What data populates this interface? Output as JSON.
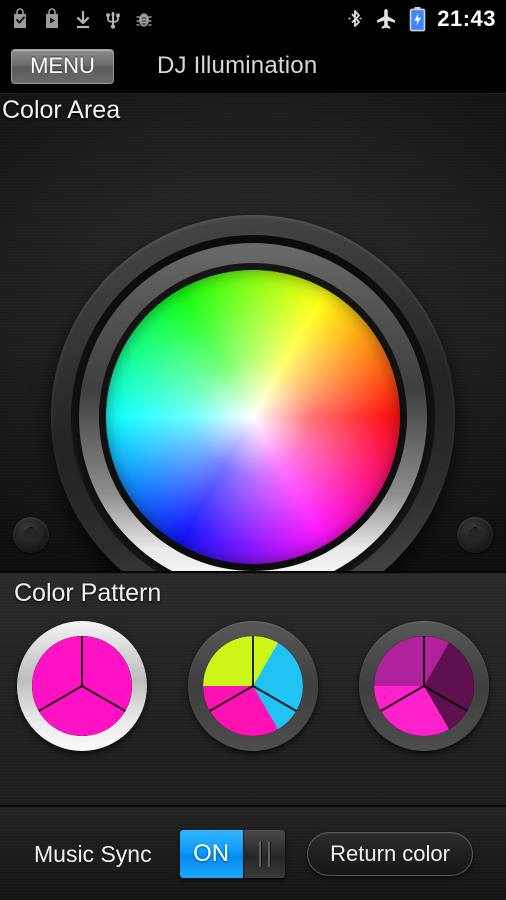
{
  "status_bar": {
    "left_icons": [
      {
        "name": "app-install-check-icon",
        "glyph": "check-bag"
      },
      {
        "name": "play-store-icon",
        "glyph": "play-bag"
      },
      {
        "name": "download-icon",
        "glyph": "download"
      },
      {
        "name": "usb-icon",
        "glyph": "usb"
      },
      {
        "name": "usb-debug-icon",
        "glyph": "bug"
      }
    ],
    "right_icons": [
      {
        "name": "bluetooth-icon",
        "glyph": "bluetooth"
      },
      {
        "name": "airplane-mode-icon",
        "glyph": "airplane"
      },
      {
        "name": "battery-charging-icon",
        "glyph": "battery"
      }
    ],
    "clock": "21:43"
  },
  "title_bar": {
    "menu_label": "MENU",
    "app_title": "DJ Illumination"
  },
  "color_area": {
    "section_label": "Color Area",
    "wheel": {
      "type": "hsv-color-wheel",
      "center_color": "#ffffff",
      "hue_stops": [
        {
          "angle_deg": 0,
          "color": "#ff0000"
        },
        {
          "angle_deg": 60,
          "color": "#ffff00"
        },
        {
          "angle_deg": 120,
          "color": "#00ff00"
        },
        {
          "angle_deg": 180,
          "color": "#00ffff"
        },
        {
          "angle_deg": 240,
          "color": "#0000ff"
        },
        {
          "angle_deg": 300,
          "color": "#ff00ff"
        }
      ]
    },
    "screws": [
      "screw-left",
      "screw-right"
    ]
  },
  "color_pattern": {
    "section_label": "Color Pattern",
    "patterns": [
      {
        "name": "pattern-1",
        "selected": true,
        "segments": [
          "#ff11c4",
          "#ff11c4",
          "#ff11c4"
        ],
        "ring_color": "#e8e8e8"
      },
      {
        "name": "pattern-2",
        "selected": false,
        "segments": [
          "#ff11b4",
          "#ccf615",
          "#21c3f5"
        ],
        "ring_color": "#4a4a4a"
      },
      {
        "name": "pattern-3",
        "selected": false,
        "segments": [
          "#ff22cc",
          "#b0229c",
          "#5e1050"
        ],
        "ring_color": "#4a4a4a"
      }
    ]
  },
  "bottom_bar": {
    "music_sync_label": "Music Sync",
    "music_sync_value": "ON",
    "music_sync_state": true,
    "return_color_label": "Return color"
  },
  "theme": {
    "background": "#1b1b1b",
    "text": "#f2f2f2",
    "accent_blue": "#0a9bfb",
    "accent_magenta": "#ff11c4"
  }
}
